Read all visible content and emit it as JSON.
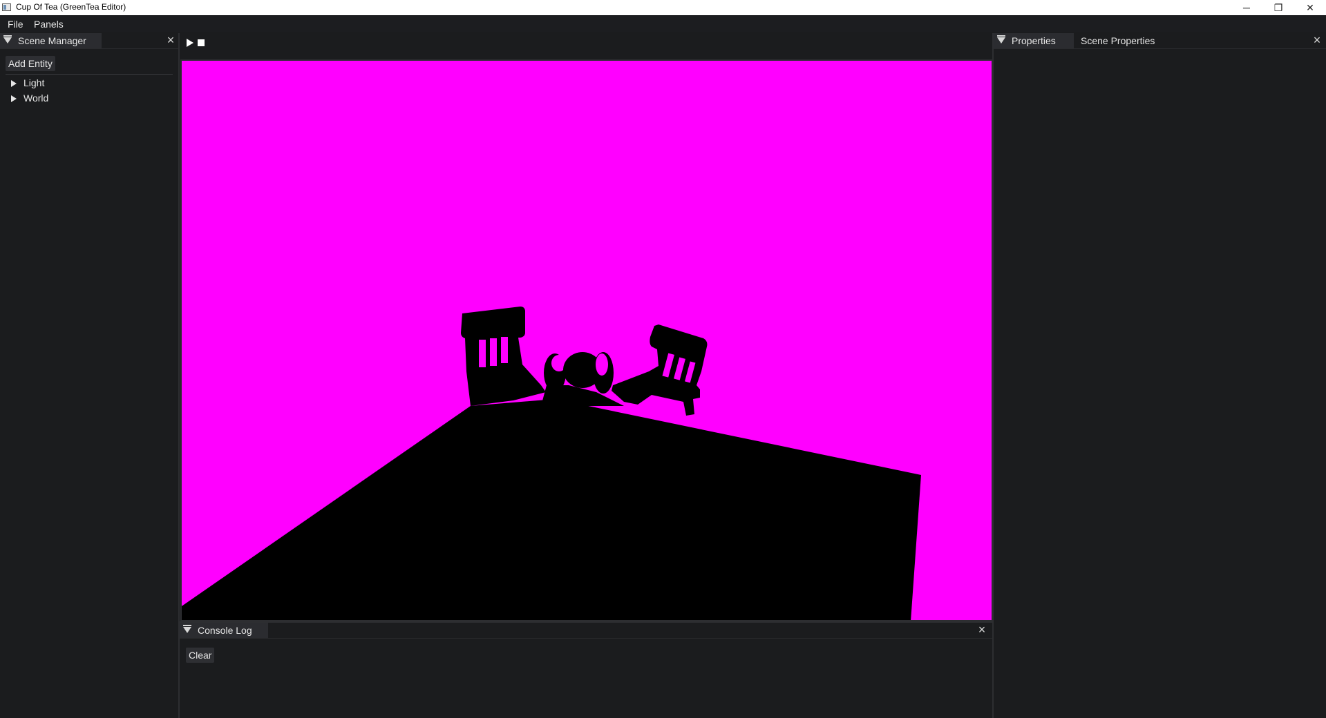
{
  "window": {
    "title": "Cup Of Tea (GreenTea Editor)",
    "minimize_glyph": "─",
    "restore_glyph": "❐",
    "close_glyph": "✕"
  },
  "menu": {
    "items": [
      "File",
      "Panels"
    ]
  },
  "scene_manager": {
    "tab_label": "Scene Manager",
    "add_entity_label": "Add Entity",
    "tree": [
      {
        "label": "Light"
      },
      {
        "label": "World"
      }
    ]
  },
  "viewport": {
    "play_icon": "play-icon",
    "stop_icon": "stop-icon",
    "clear_color": "#ff00ff"
  },
  "properties": {
    "tabs": [
      "Properties",
      "Scene Properties"
    ]
  },
  "console": {
    "tab_label": "Console Log",
    "clear_label": "Clear"
  },
  "colors": {
    "background": "#1b1c1e",
    "accent_magenta": "#ff00ff",
    "silhouette": "#000000"
  }
}
